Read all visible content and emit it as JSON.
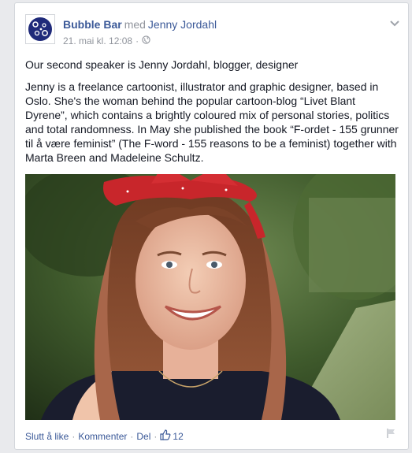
{
  "post": {
    "page_name": "Bubble Bar",
    "with_word": "med",
    "tagged_name": "Jenny Jordahl",
    "timestamp": "21. mai kl. 12:08",
    "separator": "·",
    "avatar_text": "BUBBLE",
    "privacy_icon": "globe-icon",
    "menu_icon": "chevron-down-icon",
    "paragraph_1": "Our second speaker is Jenny Jordahl, blogger, designer",
    "paragraph_2": "Jenny is a freelance cartoonist, illustrator and graphic designer, based in Oslo. She's the woman behind the popular cartoon-blog “Livet Blant Dyrene”, which contains a brightly coloured mix of personal stories, politics and total randomness. In May she published the book “F-ordet - 155 grunner til å være feminist” (The F-word - 155 reasons to be a feminist) together with Marta Breen and Madeleine Schultz.",
    "photo_icon": "portrait-photo"
  },
  "actions": {
    "unlike": "Slutt å like",
    "comment": "Kommenter",
    "share": "Del",
    "like_count": "12",
    "like_icon": "thumbs-up-icon",
    "flag_icon": "flag-icon"
  },
  "colors": {
    "link": "#3b5998",
    "muted": "#90949c",
    "text": "#141823",
    "background": "#e9eaed"
  }
}
